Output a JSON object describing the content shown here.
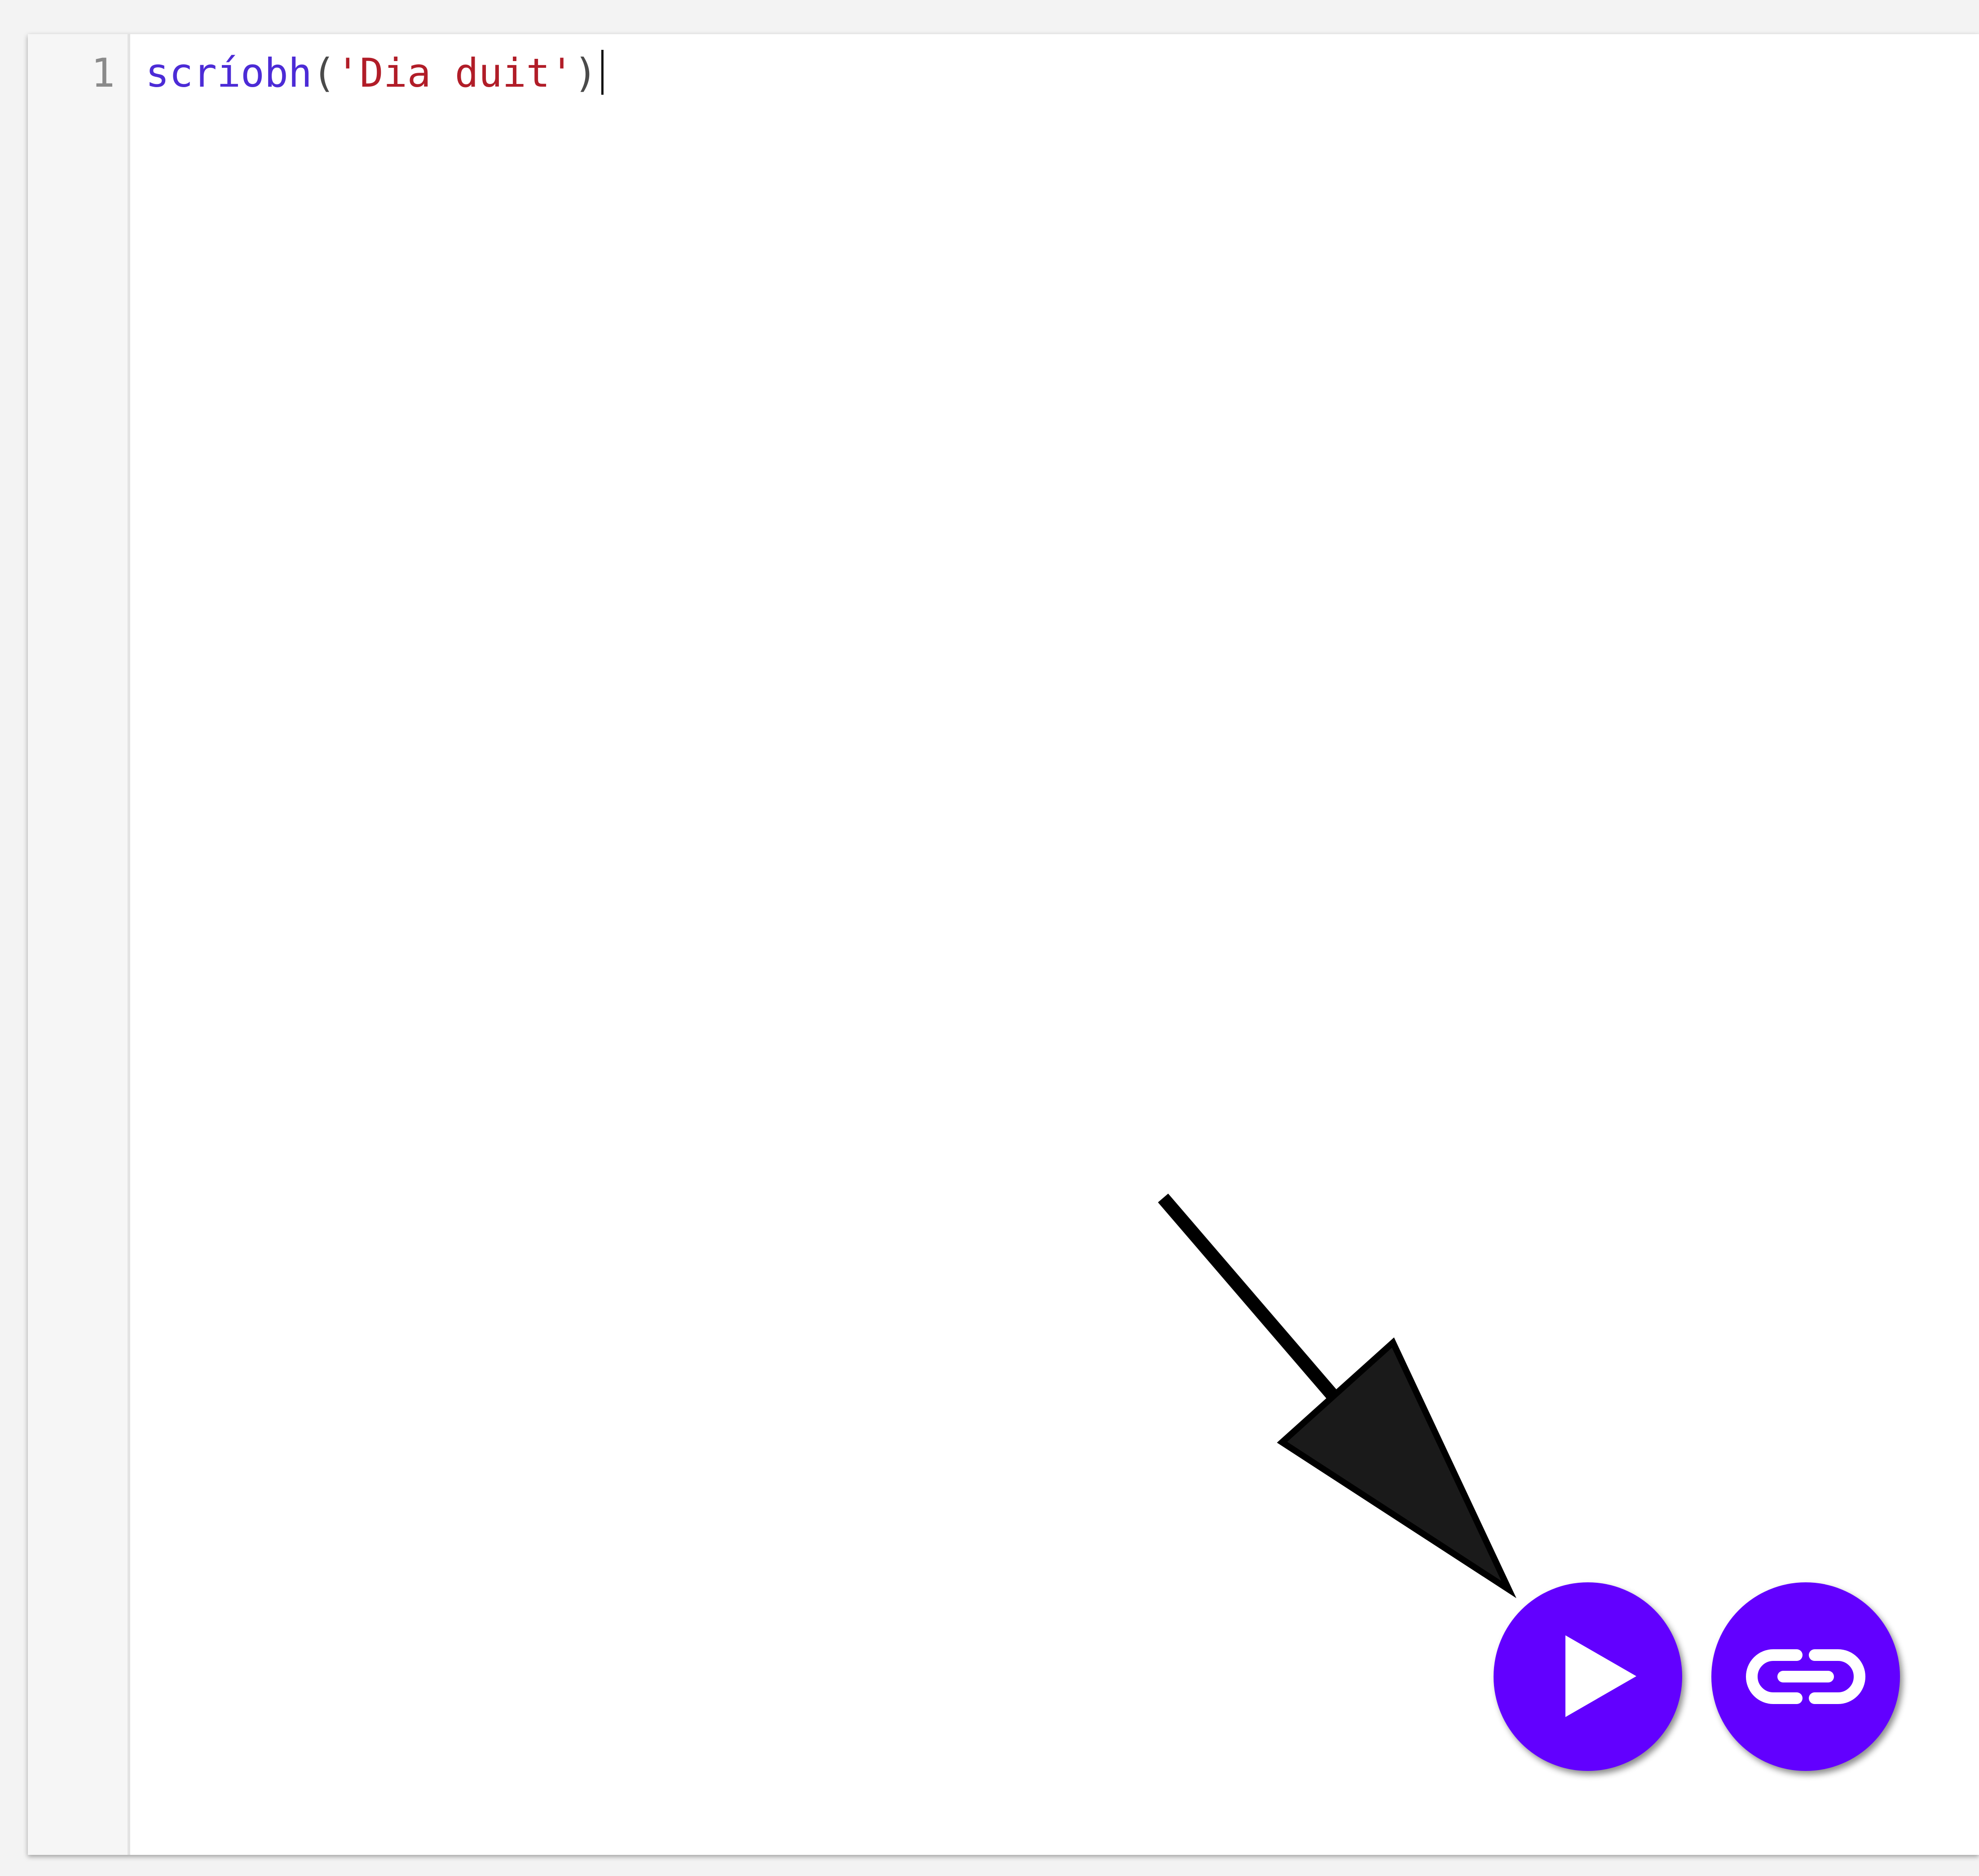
{
  "editor": {
    "line_number": "1",
    "code": {
      "func": "scríobh",
      "open_paren": "(",
      "string": "'Dia duit'",
      "close_paren": ")"
    }
  },
  "buttons": {
    "run": {
      "icon": "play-icon",
      "color": "#6200ff"
    },
    "share": {
      "icon": "link-icon",
      "color": "#6200ff"
    }
  },
  "colors": {
    "function": "#4c2bd6",
    "string": "#b11d28",
    "accent": "#6200ff"
  }
}
